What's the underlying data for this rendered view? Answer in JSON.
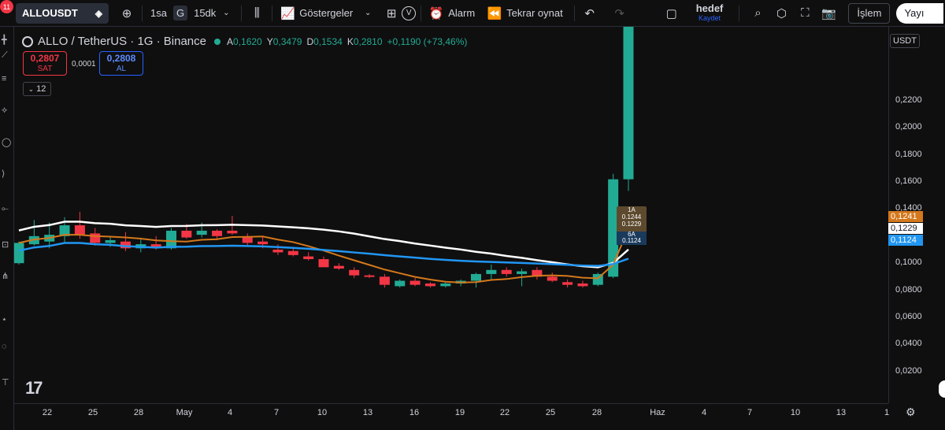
{
  "toolbar": {
    "notification_count": "11",
    "symbol": "ALLOUSDT",
    "intervals": [
      "1sa",
      "G",
      "15dk"
    ],
    "indicators_label": "Göstergeler",
    "v_label": "V",
    "alarm_label": "Alarm",
    "replay_label": "Tekrar oynat",
    "layout_title": "hedef",
    "layout_save": "Kaydet",
    "trade_label": "İşlem",
    "publish_label": "Yayı"
  },
  "legend": {
    "title": "ALLO / TetherUS · 1G · Binance",
    "ohlc": [
      {
        "k": "A",
        "v": "0,1620"
      },
      {
        "k": "Y",
        "v": "0,3479"
      },
      {
        "k": "D",
        "v": "0,1534"
      },
      {
        "k": "K",
        "v": "0,2810"
      },
      {
        "k": "",
        "v": "+0,1190 (+73,46%)"
      }
    ]
  },
  "trade": {
    "sell_price": "0,2807",
    "sell_label": "SAT",
    "spread": "0,0001",
    "buy_price": "0,2808",
    "buy_label": "AL",
    "collapse_count": "12"
  },
  "price_axis": {
    "currency": "USDT",
    "ticks": [
      "0,2200",
      "0,2000",
      "0,1800",
      "0,1600",
      "0,1400",
      "0,1000",
      "0,0800",
      "0,0600",
      "0,0400",
      "0,0200"
    ],
    "labels": [
      {
        "text": "0,1241",
        "bg": "#d4781c",
        "fg": "#ffffff"
      },
      {
        "text": "0,1229",
        "bg": "#ffffff",
        "fg": "#131722"
      },
      {
        "text": "0,1124",
        "bg": "#2196f3",
        "fg": "#ffffff"
      }
    ]
  },
  "time_axis": [
    "22",
    "25",
    "28",
    "May",
    "4",
    "7",
    "10",
    "13",
    "16",
    "19",
    "22",
    "25",
    "28",
    "Haz",
    "4",
    "7",
    "10",
    "13",
    "1"
  ],
  "tooltip": {
    "lines": [
      "1A",
      "0.1244",
      "0.1229"
    ],
    "lines2": [
      "6A",
      "0.1124"
    ]
  },
  "colors": {
    "up": "#22ab94",
    "down": "#f23645",
    "ma_white": "#ffffff",
    "ma_orange": "#d4781c",
    "ma_blue": "#2196f3"
  },
  "candles": [
    {
      "o": 0.1,
      "h": 0.116,
      "l": 0.099,
      "c": 0.115
    },
    {
      "o": 0.114,
      "h": 0.132,
      "l": 0.113,
      "c": 0.12
    },
    {
      "o": 0.116,
      "h": 0.13,
      "l": 0.111,
      "c": 0.121
    },
    {
      "o": 0.12,
      "h": 0.134,
      "l": 0.115,
      "c": 0.128
    },
    {
      "o": 0.128,
      "h": 0.138,
      "l": 0.118,
      "c": 0.121
    },
    {
      "o": 0.122,
      "h": 0.126,
      "l": 0.113,
      "c": 0.115
    },
    {
      "o": 0.115,
      "h": 0.12,
      "l": 0.112,
      "c": 0.117
    },
    {
      "o": 0.116,
      "h": 0.123,
      "l": 0.109,
      "c": 0.111
    },
    {
      "o": 0.111,
      "h": 0.118,
      "l": 0.108,
      "c": 0.114
    },
    {
      "o": 0.114,
      "h": 0.12,
      "l": 0.11,
      "c": 0.112
    },
    {
      "o": 0.111,
      "h": 0.126,
      "l": 0.11,
      "c": 0.124
    },
    {
      "o": 0.124,
      "h": 0.129,
      "l": 0.118,
      "c": 0.119
    },
    {
      "o": 0.121,
      "h": 0.13,
      "l": 0.119,
      "c": 0.124
    },
    {
      "o": 0.124,
      "h": 0.125,
      "l": 0.117,
      "c": 0.12
    },
    {
      "o": 0.124,
      "h": 0.135,
      "l": 0.121,
      "c": 0.122
    },
    {
      "o": 0.119,
      "h": 0.122,
      "l": 0.113,
      "c": 0.115
    },
    {
      "o": 0.116,
      "h": 0.12,
      "l": 0.111,
      "c": 0.114
    },
    {
      "o": 0.11,
      "h": 0.114,
      "l": 0.106,
      "c": 0.108
    },
    {
      "o": 0.109,
      "h": 0.112,
      "l": 0.105,
      "c": 0.106
    },
    {
      "o": 0.105,
      "h": 0.108,
      "l": 0.102,
      "c": 0.103
    },
    {
      "o": 0.103,
      "h": 0.105,
      "l": 0.098,
      "c": 0.097
    },
    {
      "o": 0.098,
      "h": 0.1,
      "l": 0.095,
      "c": 0.096
    },
    {
      "o": 0.095,
      "h": 0.097,
      "l": 0.089,
      "c": 0.091
    },
    {
      "o": 0.091,
      "h": 0.092,
      "l": 0.089,
      "c": 0.09
    },
    {
      "o": 0.09,
      "h": 0.092,
      "l": 0.082,
      "c": 0.084
    },
    {
      "o": 0.083,
      "h": 0.088,
      "l": 0.082,
      "c": 0.087
    },
    {
      "o": 0.087,
      "h": 0.089,
      "l": 0.083,
      "c": 0.084
    },
    {
      "o": 0.085,
      "h": 0.086,
      "l": 0.082,
      "c": 0.083
    },
    {
      "o": 0.083,
      "h": 0.086,
      "l": 0.082,
      "c": 0.085
    },
    {
      "o": 0.085,
      "h": 0.088,
      "l": 0.083,
      "c": 0.087
    },
    {
      "o": 0.087,
      "h": 0.093,
      "l": 0.082,
      "c": 0.092
    },
    {
      "o": 0.092,
      "h": 0.099,
      "l": 0.088,
      "c": 0.095
    },
    {
      "o": 0.095,
      "h": 0.097,
      "l": 0.09,
      "c": 0.092
    },
    {
      "o": 0.092,
      "h": 0.096,
      "l": 0.083,
      "c": 0.094
    },
    {
      "o": 0.095,
      "h": 0.097,
      "l": 0.088,
      "c": 0.09
    },
    {
      "o": 0.09,
      "h": 0.093,
      "l": 0.086,
      "c": 0.087
    },
    {
      "o": 0.086,
      "h": 0.088,
      "l": 0.082,
      "c": 0.084
    },
    {
      "o": 0.085,
      "h": 0.087,
      "l": 0.082,
      "c": 0.083
    },
    {
      "o": 0.084,
      "h": 0.093,
      "l": 0.083,
      "c": 0.092
    },
    {
      "o": 0.09,
      "h": 0.166,
      "l": 0.089,
      "c": 0.162
    },
    {
      "o": 0.162,
      "h": 0.3479,
      "l": 0.1534,
      "c": 0.281
    }
  ]
}
